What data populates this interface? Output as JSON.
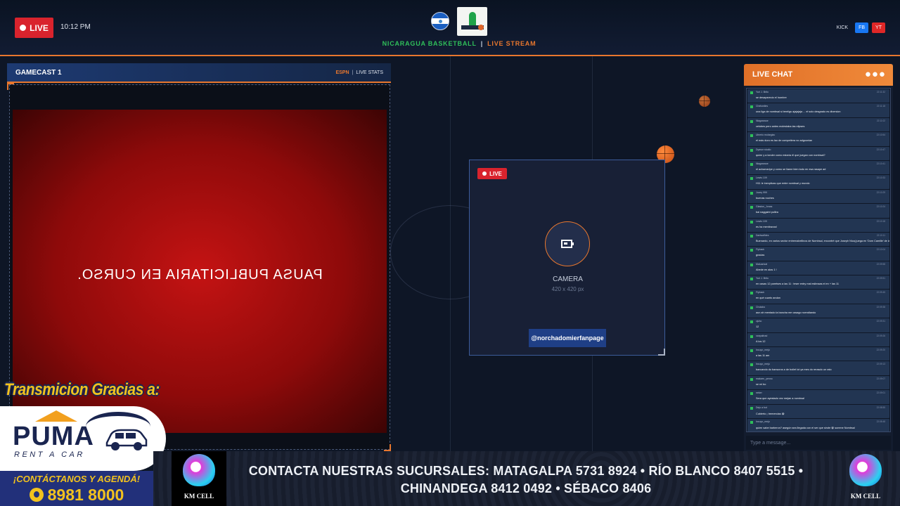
{
  "header": {
    "live_label": "LIVE",
    "clock": "10:12 PM",
    "brand_left": "NICARAGUA BASKETBALL",
    "brand_sep": "|",
    "brand_right": "LIVE STREAM",
    "logo_icon": "team-logo-icon",
    "flag_icon": "nicaragua-flag-icon",
    "socials": {
      "kick": "KICK",
      "fb": "FB",
      "yt": "YT"
    }
  },
  "gamecast": {
    "title": "GAMECAST 1",
    "source": "ESPN",
    "sep": "|",
    "stats_label": "LIVE STATS",
    "overlay_text": "PAUSA PUBLICITARIA EN CURSO."
  },
  "camera": {
    "live_label": "LIVE",
    "icon": "camera-icon",
    "label": "CAMERA",
    "size": "420 x 420 px",
    "handle": "@norchadomierfanpage"
  },
  "chat": {
    "title": "LIVE CHAT",
    "more": "●●●",
    "input_placeholder": "Type a message...",
    "messages": [
      {
        "user": "Yuri J. Brito",
        "text": "se desaparecio el hombre",
        "time": "22:11:32"
      },
      {
        "user": "Chelsmiles",
        "text": "una liga de nombsal si tereligs ajajajaja ... el solo desgrado es diversion",
        "time": "22:11:18"
      },
      {
        "user": "Niagarasse",
        "text": "celobes pero antes molestaba las elipses",
        "time": "22:11:02"
      },
      {
        "user": "Uinerio molargiac",
        "text": "el más duro es lao de competiera no adgoonian",
        "time": "22:10:54"
      },
      {
        "user": "Dyasor studio",
        "text": "quien y a londer como estaría él que juegan con nombsal?",
        "time": "22:10:47"
      },
      {
        "user": "Niagarasse",
        "text": "el achamaripe y como se llame bien todo en esa rasape ad",
        "time": "22:10:41"
      },
      {
        "user": "Lewis 109",
        "text": "H11 le inexplicas que entre nombsal y mundo",
        "time": "22:10:33"
      },
      {
        "user": "Jozey 999",
        "text": "buenas noches",
        "time": "22:10:29"
      },
      {
        "user": "Glaston_Jonas",
        "text": "bai naggaint pullira",
        "time": "22:10:24"
      },
      {
        "user": "Lewis 109",
        "text": "es ha mentiravos!",
        "time": "22:10:18"
      },
      {
        "user": "Dartwalfdes",
        "text": "Buenardo, en varios sector entremabellinos de Nombsal, encontré que Joseph Nicaj juega en 'Dom Camille' de la Liga ACB de España. Parece confirmado en Panamá.",
        "time": "22:10:11"
      },
      {
        "user": "Flyback",
        "text": "gracias",
        "time": "22:10:04"
      },
      {
        "user": "Maluaricat",
        "text": "Abede en alas 1 !",
        "time": "22:09:58"
      },
      {
        "user": "Yuri J. Brito",
        "text": "en casas 12 paretses a las 11 : teser entry mal eslimaas el en + las 11",
        "time": "22:09:51"
      },
      {
        "user": "Flyback",
        "text": "en qué cuarto andan",
        "time": "22:09:45"
      },
      {
        "user": "Chotabo",
        "text": "aun ah mentado la bancha me casago ncendiando",
        "time": "22:09:38"
      },
      {
        "user": "cjuho",
        "text": "12",
        "time": "22:09:31"
      },
      {
        "user": "xanpaltrad",
        "text": "A los 12",
        "time": "22:09:26"
      },
      {
        "user": "Incuyo_mejo",
        "text": "a las 11 am",
        "time": "22:09:20"
      },
      {
        "user": "Incuyo_mejo",
        "text": "bancando do bansoros a de boilet lot ya mes do rerasdo un rato",
        "time": "22:09:13"
      },
      {
        "user": "makzen_yenno",
        "text": "se mi bo",
        "time": "22:09:07"
      },
      {
        "user": "neker",
        "text": "Sera que ayestado vez mejan a nombsal",
        "time": "22:09:01"
      },
      {
        "user": "Dejo a bot",
        "text": "Cubierto ¡ tremendas 😀",
        "time": "22:08:55"
      },
      {
        "user": "Incuyo_mejo",
        "text": "quien sabe barberon? asegún sea llegada con el ser que sirote 😀 somme Nombsal",
        "time": "22:08:48"
      }
    ]
  },
  "sponsor": {
    "heading": "Transmicion Gracias a:",
    "brand": "PUMA",
    "sub": "RENT A CAR",
    "cta": "¡CONTÁCTANOS Y AGENDÁ!",
    "phone": "8981 8000",
    "whatsapp_icon": "whatsapp-icon"
  },
  "ticker": {
    "logo_text": "KM CELL",
    "line1": "CONTACTA NUESTRAS SUCURSALES: MATAGALPA 5731 8924 • RÍO BLANCO 8407 5515 •",
    "line2": "CHINANDEGA 8412 0492 • SÉBACO 8406"
  },
  "colors": {
    "accent": "#e8772e",
    "live_red": "#d9232d",
    "brand_green": "#2fbf5a",
    "panel_blue": "#1d3a72",
    "sponsor_yellow": "#f2c21e"
  }
}
